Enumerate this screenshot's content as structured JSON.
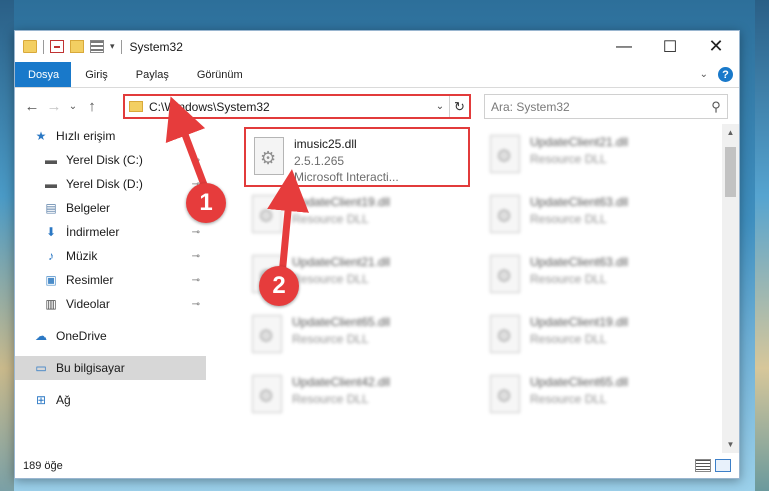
{
  "window": {
    "title": "System32",
    "controls": {
      "minimize": "—",
      "maximize": "☐",
      "close": "✕"
    }
  },
  "ribbon": {
    "tabs": [
      "Dosya",
      "Giriş",
      "Paylaş",
      "Görünüm"
    ],
    "help": "?"
  },
  "nav": {
    "back": "←",
    "forward": "→",
    "recent": "⌄",
    "up": "↑",
    "address": "C:\\Windows\\System32",
    "refresh": "↻",
    "search_placeholder": "Ara: System32"
  },
  "sidebar": {
    "items": [
      {
        "label": "Hızlı erişim",
        "icon": "star-icon",
        "glyph": "★",
        "color": "#2b78c4",
        "pinned": false
      },
      {
        "label": "Yerel Disk (C:)",
        "icon": "drive-icon",
        "glyph": "▬",
        "color": "#555555",
        "pinned": true
      },
      {
        "label": "Yerel Disk (D:)",
        "icon": "drive-icon",
        "glyph": "▬",
        "color": "#555555",
        "pinned": true
      },
      {
        "label": "Belgeler",
        "icon": "document-icon",
        "glyph": "▤",
        "color": "#5a7fa8",
        "pinned": true
      },
      {
        "label": "İndirmeler",
        "icon": "download-icon",
        "glyph": "⬇",
        "color": "#2b78c4",
        "pinned": true
      },
      {
        "label": "Müzik",
        "icon": "music-icon",
        "glyph": "♪",
        "color": "#2b78c4",
        "pinned": true
      },
      {
        "label": "Resimler",
        "icon": "pictures-icon",
        "glyph": "▣",
        "color": "#4a8cc9",
        "pinned": true
      },
      {
        "label": "Videolar",
        "icon": "video-icon",
        "glyph": "▥",
        "color": "#444444",
        "pinned": true
      },
      {
        "label": "OneDrive",
        "icon": "cloud-icon",
        "glyph": "☁",
        "color": "#2b78c4",
        "pinned": false
      },
      {
        "label": "Bu bilgisayar",
        "icon": "computer-icon",
        "glyph": "▭",
        "color": "#2b78c4",
        "pinned": false,
        "selected": true
      },
      {
        "label": "Ağ",
        "icon": "network-icon",
        "glyph": "⊞",
        "color": "#2b78c4",
        "pinned": false
      }
    ],
    "pin_glyph": "📌"
  },
  "files": [
    {
      "name": "imusic25.dll",
      "version": "2.5.1.265",
      "desc": "Microsoft Interacti...",
      "highlight": true
    },
    {
      "name": "UpdateClient21.dll",
      "version": "Resource DLL",
      "desc": ""
    },
    {
      "name": "UpdateClient19.dll",
      "version": "Resource DLL",
      "desc": ""
    },
    {
      "name": "UpdateClient63.dll",
      "version": "Resource DLL",
      "desc": ""
    },
    {
      "name": "UpdateClient21.dll",
      "version": "Resource DLL",
      "desc": ""
    },
    {
      "name": "UpdateClient63.dll",
      "version": "Resource DLL",
      "desc": ""
    },
    {
      "name": "UpdateClient65.dll",
      "version": "Resource DLL",
      "desc": ""
    },
    {
      "name": "UpdateClient19.dll",
      "version": "Resource DLL",
      "desc": ""
    },
    {
      "name": "UpdateClient42.dll",
      "version": "Resource DLL",
      "desc": ""
    },
    {
      "name": "UpdateClient65.dll",
      "version": "Resource DLL",
      "desc": ""
    }
  ],
  "status": {
    "count": "189 öğe"
  },
  "annotations": [
    {
      "number": "1"
    },
    {
      "number": "2"
    }
  ],
  "colors": {
    "accent": "#1979ca",
    "annotation": "#e63c3c"
  }
}
